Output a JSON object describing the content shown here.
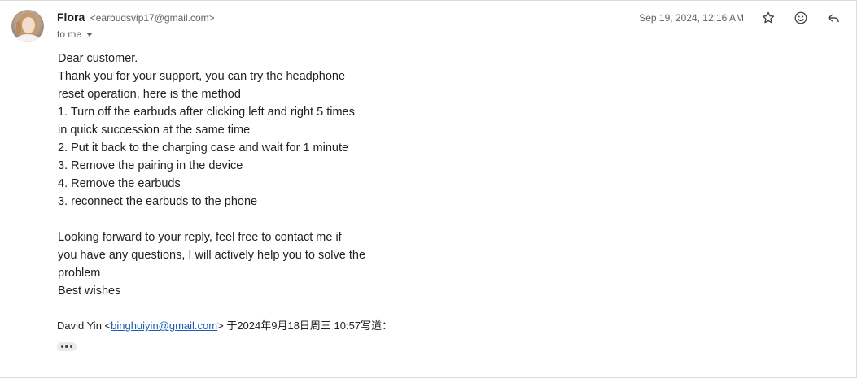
{
  "sender": {
    "name": "Flora",
    "email": "<earbudsvip17@gmail.com>",
    "recipient_label": "to me"
  },
  "date": "Sep 19, 2024, 12:16 AM",
  "icons": {
    "star": "star-icon",
    "emoji": "emoji-icon",
    "reply": "reply-icon",
    "more": "more-icon"
  },
  "body_lines": [
    "Dear customer.",
    "Thank you for your support, you can try the headphone",
    "reset operation, here is the method",
    "1. Turn off the earbuds after clicking left and right 5 times",
    "in quick succession at the same time",
    "2. Put it back to the charging case and wait for 1 minute",
    "3. Remove the pairing in the device",
    "4. Remove the earbuds",
    "3. reconnect the earbuds to the phone",
    "",
    "Looking forward to your reply, feel free to contact me if",
    "you have any questions, I will actively help you to solve the",
    "problem",
    "Best wishes"
  ],
  "quote": {
    "name_prefix": "David Yin <",
    "email_link": "binghuiyin@gmail.com",
    "suffix": "> 于2024年9月18日周三 10:57写道："
  },
  "colors": {
    "link": "#1a5fb4",
    "secondary_text": "#5f6368"
  }
}
